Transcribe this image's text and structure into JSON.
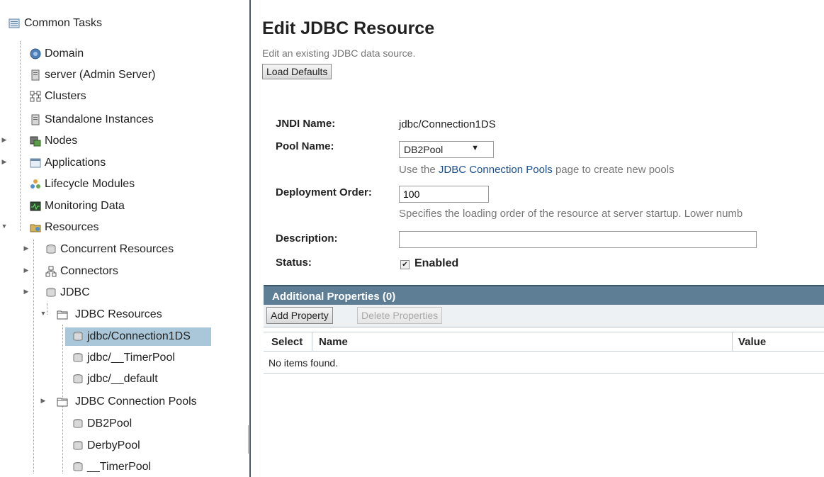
{
  "tree": {
    "common_tasks": "Common Tasks",
    "items": [
      {
        "label": "Domain",
        "icon": "globe-icon"
      },
      {
        "label": "server (Admin Server)",
        "icon": "server-icon"
      },
      {
        "label": "Clusters",
        "icon": "clusters-icon"
      },
      {
        "label": "Standalone Instances",
        "icon": "server-icon"
      },
      {
        "label": "Nodes",
        "icon": "nodes-icon"
      },
      {
        "label": "Applications",
        "icon": "applications-icon"
      },
      {
        "label": "Lifecycle Modules",
        "icon": "lifecycle-icon"
      },
      {
        "label": "Monitoring Data",
        "icon": "monitoring-icon"
      },
      {
        "label": "Resources",
        "icon": "resources-icon"
      },
      {
        "label": "Concurrent Resources",
        "icon": "database-icon"
      },
      {
        "label": "Connectors",
        "icon": "connectors-icon"
      },
      {
        "label": "JDBC",
        "icon": "database-icon"
      },
      {
        "label": "JDBC Resources",
        "icon": "folder-icon"
      },
      {
        "label": "jdbc/Connection1DS",
        "icon": "database-icon"
      },
      {
        "label": "jdbc/__TimerPool",
        "icon": "database-icon"
      },
      {
        "label": "jdbc/__default",
        "icon": "database-icon"
      },
      {
        "label": "JDBC Connection Pools",
        "icon": "folder-icon"
      },
      {
        "label": "DB2Pool",
        "icon": "database-icon"
      },
      {
        "label": "DerbyPool",
        "icon": "database-icon"
      },
      {
        "label": "__TimerPool",
        "icon": "database-icon"
      }
    ]
  },
  "page": {
    "title": "Edit JDBC Resource",
    "subtitle": "Edit an existing JDBC data source.",
    "load_defaults": "Load Defaults"
  },
  "form": {
    "jndi_label": "JNDI Name:",
    "jndi_value": "jdbc/Connection1DS",
    "pool_label": "Pool Name:",
    "pool_value": "DB2Pool",
    "pool_help_pre": "Use the ",
    "pool_help_link": "JDBC Connection Pools",
    "pool_help_post": " page to create new pools",
    "order_label": "Deployment Order:",
    "order_value": "100",
    "order_help": "Specifies the loading order of the resource at server startup. Lower numb",
    "description_label": "Description:",
    "description_value": "",
    "status_label": "Status:",
    "status_enabled": "Enabled"
  },
  "properties_table": {
    "title": "Additional Properties (0)",
    "add_button": "Add Property",
    "delete_button": "Delete Properties",
    "columns": [
      "Select",
      "Name",
      "Value"
    ],
    "empty_message": "No items found."
  },
  "colors": {
    "selected_row": "#a9c7d9",
    "table_header": "#5e7e95",
    "link": "#1a4f8b"
  }
}
